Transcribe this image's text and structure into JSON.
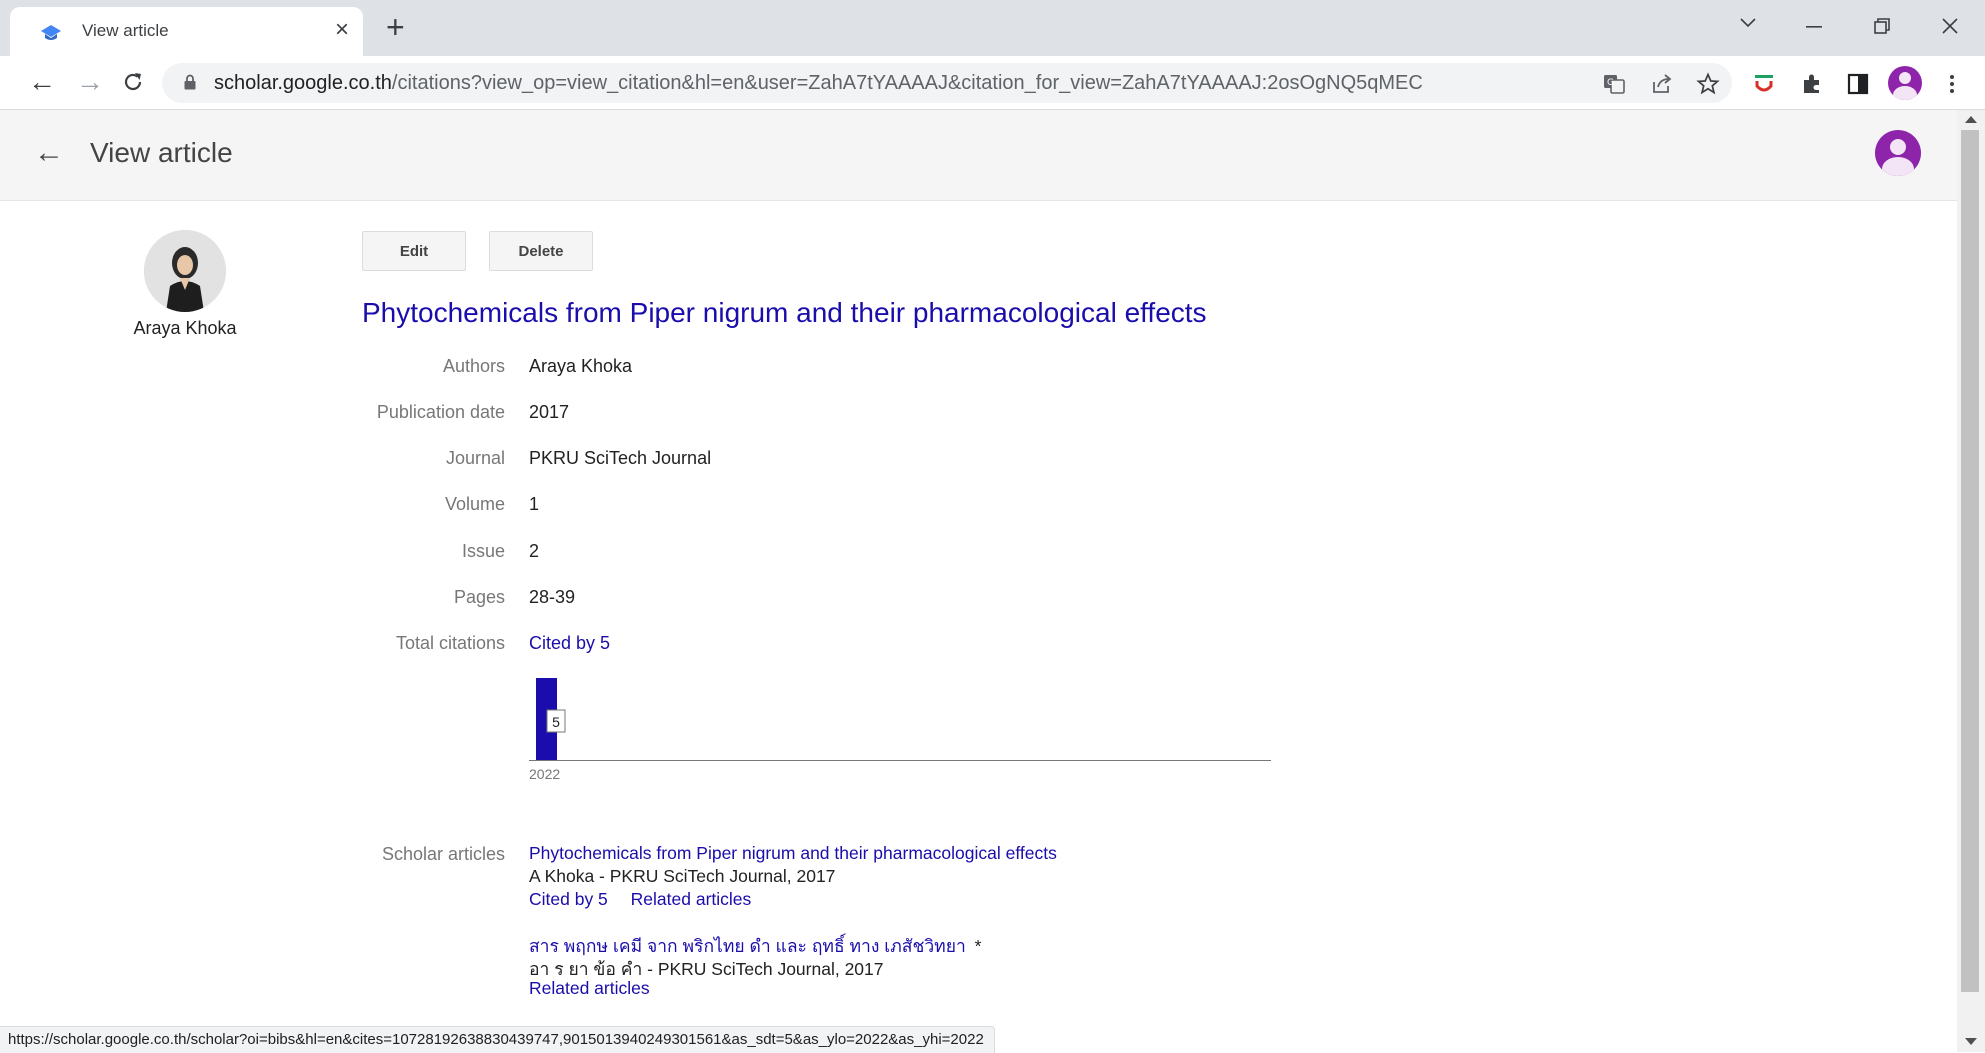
{
  "browser": {
    "tab_title": "View article",
    "new_tab_label": "+",
    "url_host": "scholar.google.co.th",
    "url_path": "/citations?view_op=view_citation&hl=en&user=ZahA7tYAAAAJ&citation_for_view=ZahA7tYAAAAJ:2osOgNQ5qMEC",
    "status_url": "https://scholar.google.co.th/scholar?oi=bibs&hl=en&cites=10728192638830439747,9015013940249301561&as_sdt=5&as_ylo=2022&as_yhi=2022"
  },
  "header": {
    "title": "View article"
  },
  "profile": {
    "name": "Araya Khoka"
  },
  "buttons": {
    "edit": "Edit",
    "delete": "Delete"
  },
  "article": {
    "title": "Phytochemicals from Piper nigrum and their pharmacological effects",
    "fields": {
      "authors": {
        "label": "Authors",
        "value": "Araya Khoka"
      },
      "publication_date": {
        "label": "Publication date",
        "value": "2017"
      },
      "journal": {
        "label": "Journal",
        "value": "PKRU SciTech Journal"
      },
      "volume": {
        "label": "Volume",
        "value": "1"
      },
      "issue": {
        "label": "Issue",
        "value": "2"
      },
      "pages": {
        "label": "Pages",
        "value": "28-39"
      },
      "total_citations": {
        "label": "Total citations",
        "value": "Cited by 5"
      },
      "scholar_articles": {
        "label": "Scholar articles"
      }
    }
  },
  "chart_data": {
    "type": "bar",
    "categories": [
      "2022"
    ],
    "values": [
      5
    ],
    "data_labels": [
      "5"
    ],
    "xlabel": "",
    "ylabel": "",
    "colors": {
      "bar": "#1a0dab"
    }
  },
  "scholar_articles": [
    {
      "title": "Phytochemicals from Piper nigrum and their pharmacological effects",
      "meta": "A Khoka - PKRU SciTech Journal, 2017",
      "cited_by": "Cited by 5",
      "related": "Related articles"
    },
    {
      "title": "สาร พฤกษ เคมี จาก พริกไทย ดำ และ ฤทธิ์ ทาง เภสัชวิทยา",
      "star": "*",
      "meta": "อา ร ยา ข้อ คำ - PKRU SciTech Journal, 2017",
      "related": "Related articles"
    }
  ],
  "colors": {
    "link": "#1a0dab",
    "account_avatar": "#8e24aa",
    "label_gray": "#777777"
  },
  "icons": {
    "favicon": "graduation-cap-icon",
    "translate": "translate-icon",
    "share": "share-icon",
    "bookmark": "star-icon",
    "extension_1": "extension-red-icon",
    "extensions": "puzzle-icon",
    "side_panel": "side-panel-icon",
    "profile": "profile-icon",
    "menu": "kebab-menu-icon"
  }
}
